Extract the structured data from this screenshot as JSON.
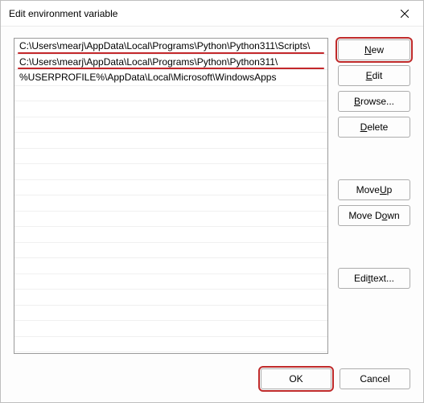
{
  "title": "Edit environment variable",
  "list": {
    "items": [
      "C:\\Users\\mearj\\AppData\\Local\\Programs\\Python\\Python311\\Scripts\\",
      "C:\\Users\\mearj\\AppData\\Local\\Programs\\Python\\Python311\\",
      "%USERPROFILE%\\AppData\\Local\\Microsoft\\WindowsApps"
    ],
    "underlined_indices": [
      0,
      1
    ]
  },
  "buttons": {
    "new": {
      "pre": "",
      "u": "N",
      "post": "ew"
    },
    "edit": {
      "pre": "",
      "u": "E",
      "post": "dit"
    },
    "browse": {
      "pre": "",
      "u": "B",
      "post": "rowse..."
    },
    "delete": {
      "pre": "",
      "u": "D",
      "post": "elete"
    },
    "moveup": {
      "pre": "Move ",
      "u": "U",
      "post": "p"
    },
    "movedown": {
      "pre": "Move D",
      "u": "o",
      "post": "wn"
    },
    "edittext": {
      "pre": "Edi",
      "u": "t",
      "post": " text..."
    },
    "ok": "OK",
    "cancel": "Cancel"
  }
}
